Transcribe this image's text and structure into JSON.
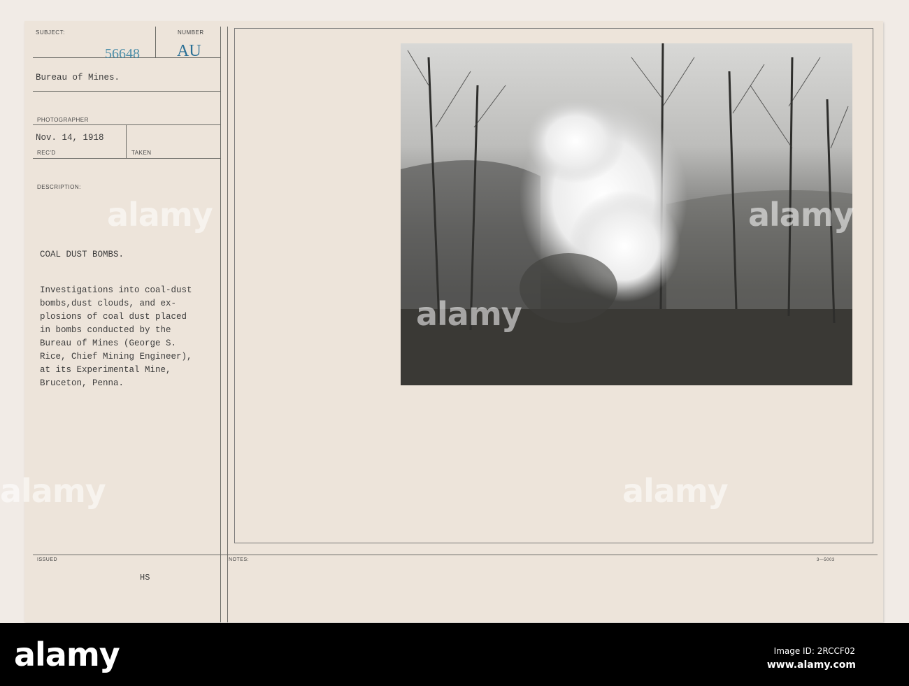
{
  "card": {
    "subject_label": "SUBJECT:",
    "number_label": "NUMBER",
    "number_stamp": "56648",
    "number_suffix": "AU",
    "subject": "Bureau of Mines.",
    "photographer_label": "PHOTOGRAPHER",
    "date": "Nov. 14, 1918",
    "recd_label": "REC'D",
    "taken_label": "TAKEN",
    "description_label": "DESCRIPTION:",
    "title": "COAL DUST BOMBS.",
    "description_lines": [
      "Investigations into coal-dust",
      "bombs,dust clouds, and ex-",
      "plosions of coal dust placed",
      "in bombs conducted by the",
      "Bureau of Mines (George S.",
      "Rice, Chief Mining Engineer),",
      "at its Experimental Mine,",
      "Bruceton, Penna."
    ],
    "issued_label": "ISSUED",
    "issued_initials": "HS",
    "notes_label": "NOTES:",
    "form_number": "3—5003"
  },
  "watermark": {
    "text": "alamy",
    "image_id": "Image ID: 2RCCF02",
    "url": "www.alamy.com"
  }
}
